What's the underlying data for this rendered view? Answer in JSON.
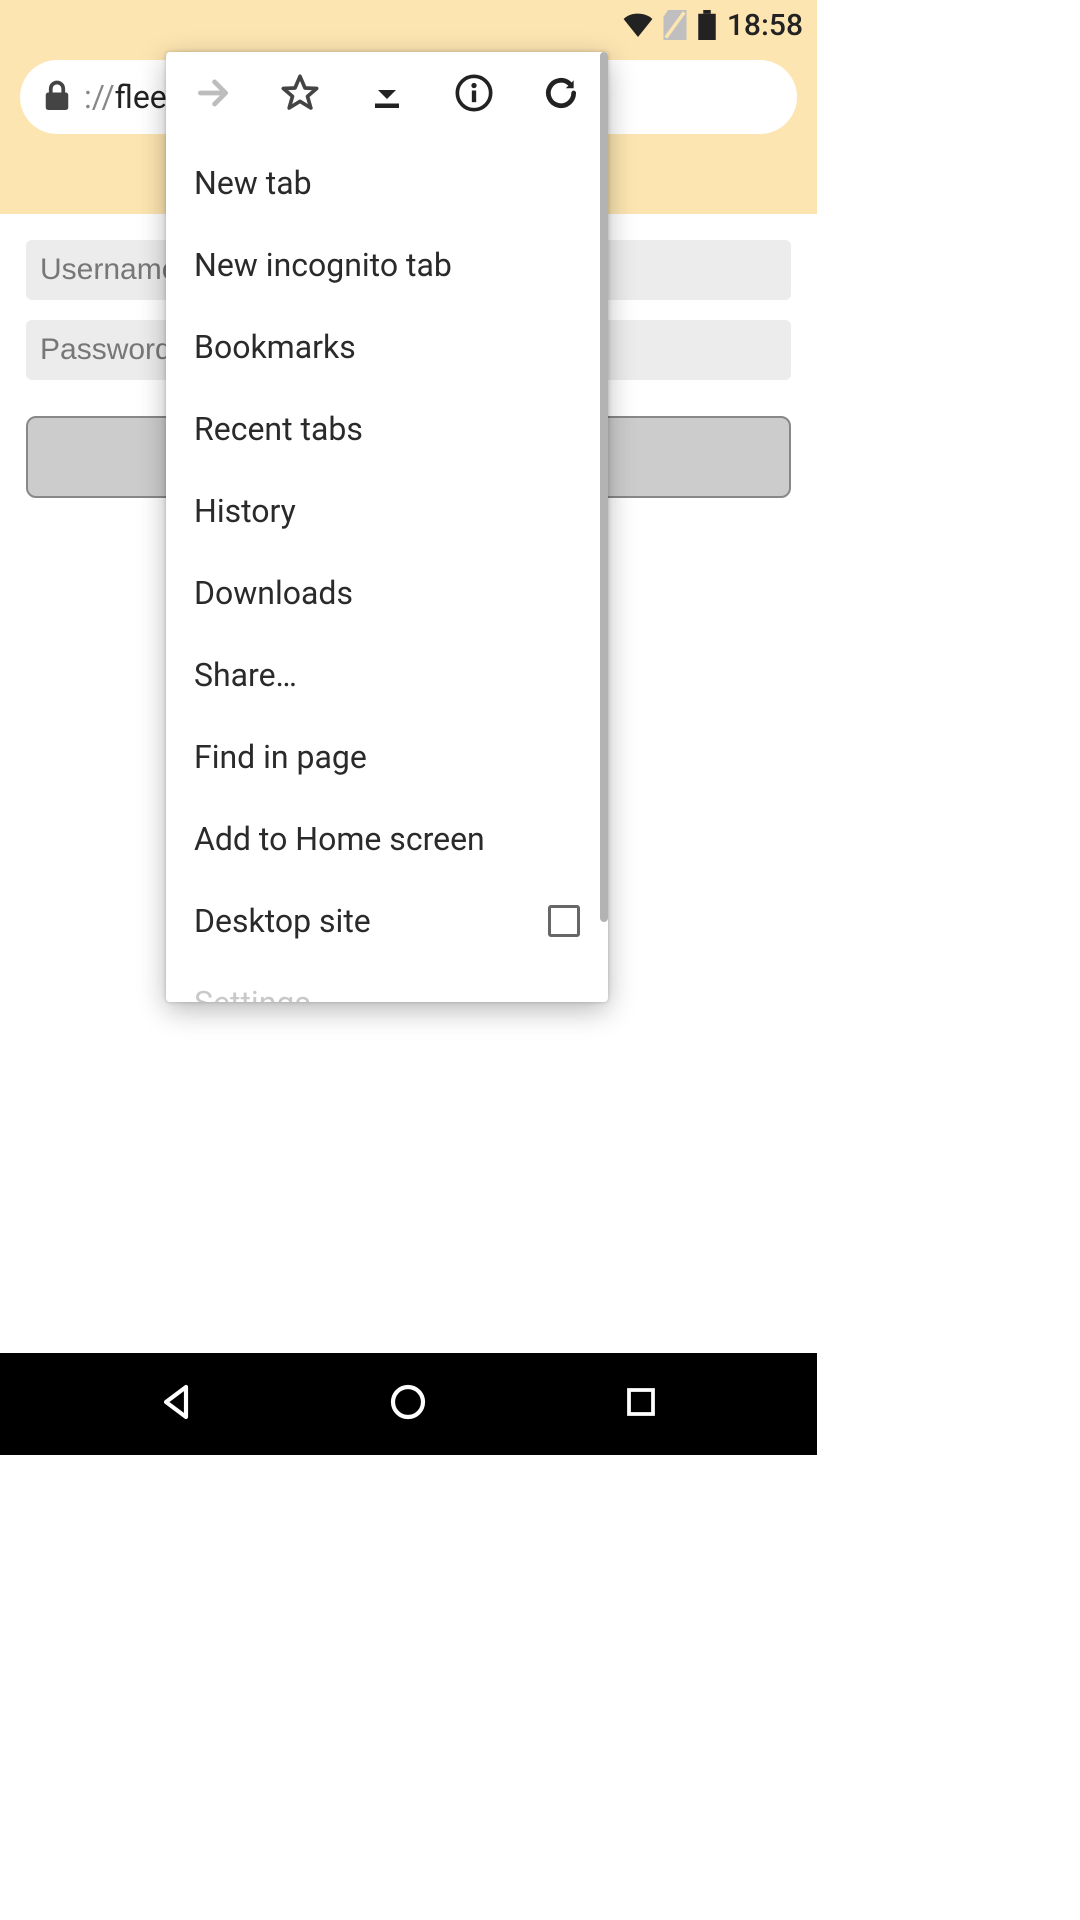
{
  "statusbar": {
    "time": "18:58",
    "wifi_icon": "wifi",
    "sim_icon": "no-sim",
    "battery_icon": "battery-full"
  },
  "addressbar": {
    "lock_icon": "lock",
    "url_scheme_text": "://",
    "url_host_text": "fleetr"
  },
  "login": {
    "username_placeholder": "Username",
    "password_placeholder": "Password",
    "login_button_label": ""
  },
  "menu": {
    "forward_icon": "arrow-forward",
    "bookmark_icon": "star-outline",
    "download_icon": "download",
    "info_icon": "info",
    "refresh_icon": "refresh",
    "items": [
      {
        "label": "New tab"
      },
      {
        "label": "New incognito tab"
      },
      {
        "label": "Bookmarks"
      },
      {
        "label": "Recent tabs"
      },
      {
        "label": "History"
      },
      {
        "label": "Downloads"
      },
      {
        "label": "Share…"
      },
      {
        "label": "Find in page"
      },
      {
        "label": "Add to Home screen"
      },
      {
        "label": "Desktop site",
        "checkbox": true
      },
      {
        "label": "Settings"
      }
    ]
  },
  "navbar": {
    "back_icon": "triangle-back",
    "home_icon": "circle",
    "recents_icon": "square"
  }
}
